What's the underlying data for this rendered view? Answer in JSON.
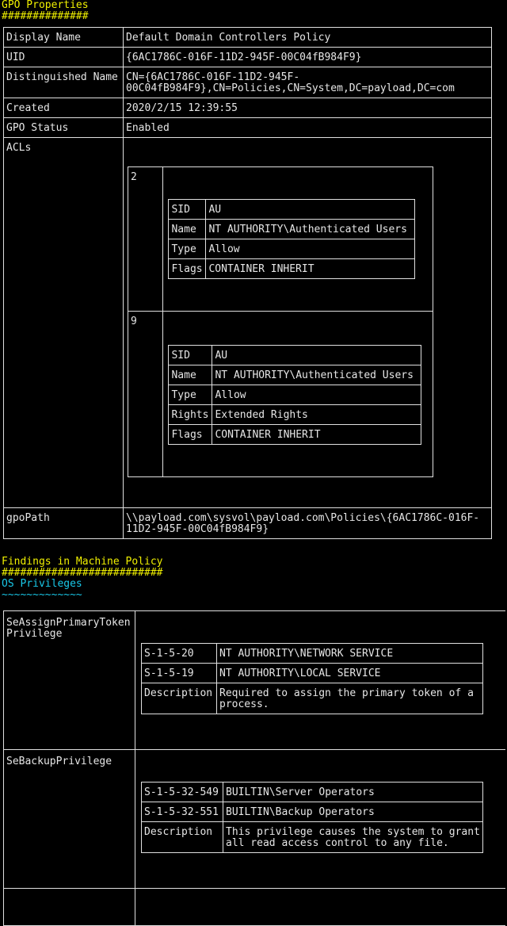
{
  "gpo": {
    "heading": "GPO Properties",
    "underline": "##############",
    "rows": {
      "display_name": {
        "key": "Display Name",
        "value": "Default Domain Controllers Policy"
      },
      "uid": {
        "key": "UID",
        "value": "{6AC1786C-016F-11D2-945F-00C04fB984F9}"
      },
      "dn": {
        "key": "Distinguished Name",
        "value": "CN={6AC1786C-016F-11D2-945F-\n00C04fB984F9},CN=Policies,CN=System,DC=payload,DC=com"
      },
      "created": {
        "key": "Created",
        "value": "2020/2/15 12:39:55"
      },
      "status": {
        "key": "GPO Status",
        "value": "Enabled"
      },
      "acls_key": "ACLs",
      "gpopath": {
        "key": "gpoPath",
        "value": "\\\\payload.com\\sysvol\\payload.com\\Policies\\{6AC1786C-016F-\n11D2-945F-00C04fB984F9}"
      }
    },
    "acls": [
      {
        "index": "2",
        "rows": [
          {
            "k": "SID",
            "v": "AU"
          },
          {
            "k": "Name",
            "v": "NT AUTHORITY\\Authenticated Users"
          },
          {
            "k": "Type",
            "v": "Allow"
          },
          {
            "k": "Flags",
            "v": "CONTAINER INHERIT"
          }
        ]
      },
      {
        "index": "9",
        "rows": [
          {
            "k": "SID",
            "v": "AU"
          },
          {
            "k": "Name",
            "v": "NT AUTHORITY\\Authenticated Users"
          },
          {
            "k": "Type",
            "v": "Allow"
          },
          {
            "k": "Rights",
            "v": "Extended Rights"
          },
          {
            "k": "Flags",
            "v": "CONTAINER INHERIT"
          }
        ]
      }
    ]
  },
  "findings": {
    "heading": "Findings in Machine Policy",
    "underline": "##########################",
    "sub_heading": "OS Privileges",
    "sub_underline": "~~~~~~~~~~~~~",
    "privileges": [
      {
        "name": "SeAssignPrimaryToken\nPrivilege",
        "rows": [
          {
            "k": "S-1-5-20",
            "v": "NT AUTHORITY\\NETWORK SERVICE"
          },
          {
            "k": "S-1-5-19",
            "v": "NT AUTHORITY\\LOCAL SERVICE"
          },
          {
            "k": "Description",
            "v": "Required to assign the primary token of a\nprocess."
          }
        ]
      },
      {
        "name": "SeBackupPrivilege",
        "rows": [
          {
            "k": "S-1-5-32-549",
            "v": "BUILTIN\\Server Operators"
          },
          {
            "k": "S-1-5-32-551",
            "v": "BUILTIN\\Backup Operators"
          },
          {
            "k": "Description",
            "v": "This privilege causes the system to grant\nall read access control to any file."
          }
        ]
      }
    ]
  }
}
